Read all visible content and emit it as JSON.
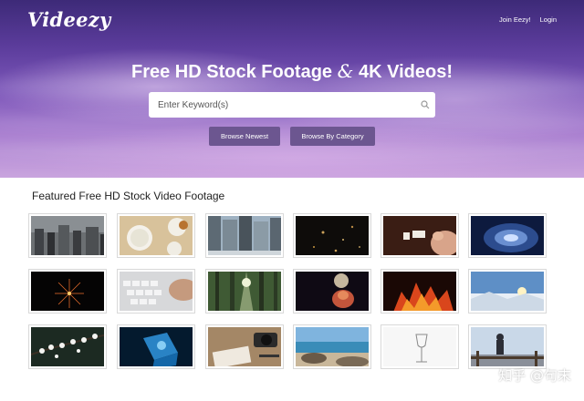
{
  "header": {
    "logo": "Videezy",
    "links": [
      "Join Eezy!",
      "Login"
    ]
  },
  "hero": {
    "title_part1": "Free HD Stock Footage ",
    "title_amp": "&",
    "title_part2": " 4K Videos!",
    "search_placeholder": "Enter Keyword(s)",
    "search_icon": "search-icon",
    "buttons": [
      "Browse Newest",
      "Browse By Category"
    ],
    "button_color": "#6c5690"
  },
  "featured": {
    "title": "Featured Free HD Stock Video Footage",
    "thumbnails": [
      "city-crowd",
      "tea-cups",
      "skyscrapers",
      "dark-particles",
      "fingers-love-tiles",
      "galaxy",
      "fireworks",
      "laptop-keyboard",
      "forest-sunbeams",
      "glowing-hand",
      "fire",
      "sunset-snow",
      "blossom-branch",
      "blue-glass-cube",
      "desk-camera",
      "beach-rocks",
      "wine-glass",
      "person-on-fence"
    ]
  },
  "watermark": "知乎 @句末"
}
